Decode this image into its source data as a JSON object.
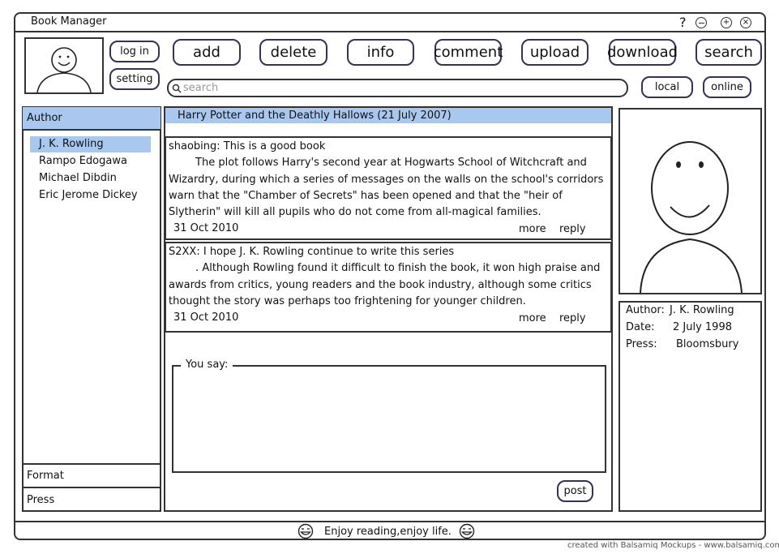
{
  "window": {
    "title": "Book Manager",
    "controls": {
      "help": "?",
      "minimize": "⊖",
      "maximize": "⊕",
      "close": "⊗"
    }
  },
  "account": {
    "login_label": "log in",
    "setting_label": "setting"
  },
  "toolbar": {
    "add": "add",
    "delete": "delete",
    "info": "info",
    "comment": "comment",
    "upload": "upload",
    "download": "download",
    "search": "search"
  },
  "search": {
    "placeholder": "search",
    "local_label": "local",
    "online_label": "online"
  },
  "sidebar": {
    "author_header": "Author",
    "authors": [
      "J. K. Rowling",
      "Rampo Edogawa",
      "Michael Dibdin",
      "Eric Jerome Dickey"
    ],
    "format_label": "Format",
    "press_label": "Press"
  },
  "book": {
    "title": "Harry Potter and the Deathly Hallows (21 July 2007)"
  },
  "comments": [
    {
      "header": "shaobing: This is a good book",
      "lines": [
        "        The plot follows Harry's second year at Hogwarts School of Witchcraft and",
        "Wizardry, during which a series of messages on the walls on the school's corridors",
        "warn that the \"Chamber of Secrets\" has been opened and that the \"heir of",
        "Slytherin\" will kill all pupils who do not come from all-magical families."
      ],
      "date": "31 Oct 2010",
      "more": "more",
      "reply": "reply"
    },
    {
      "header": "S2XX: I hope J. K. Rowling continue to write this series",
      "lines": [
        "        . Although Rowling found it difficult to finish the book, it won high praise and",
        "awards from critics, young readers and the book industry, although some critics",
        "thought the story was perhaps too frightening for younger children."
      ],
      "date": "31 Oct 2010",
      "more": "more",
      "reply": "reply"
    }
  ],
  "reply_box": {
    "legend": "You say:",
    "post_label": "post"
  },
  "details": {
    "author_label": "Author:",
    "author_value": "J. K. Rowling",
    "date_label": "Date:",
    "date_value": "2 July 1998",
    "press_label": "Press:",
    "press_value": "Bloomsbury"
  },
  "footer": {
    "text": "Enjoy reading,enjoy life."
  },
  "watermark": "created with Balsamiq Mockups - www.balsamiq.com",
  "colors": {
    "highlight": "#a9c8f0",
    "border": "#333333",
    "button_border": "#3a2f56"
  }
}
